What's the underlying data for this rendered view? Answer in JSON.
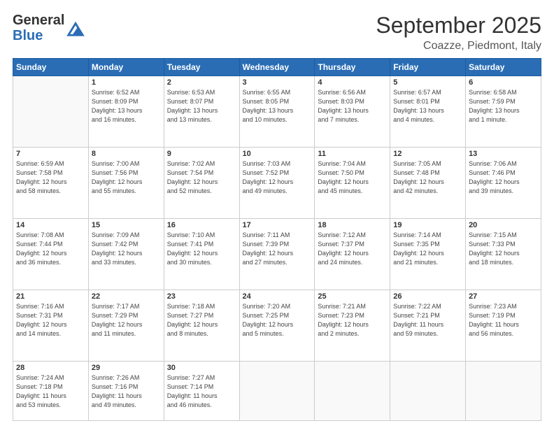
{
  "logo": {
    "general": "General",
    "blue": "Blue"
  },
  "header": {
    "month": "September 2025",
    "location": "Coazze, Piedmont, Italy"
  },
  "weekdays": [
    "Sunday",
    "Monday",
    "Tuesday",
    "Wednesday",
    "Thursday",
    "Friday",
    "Saturday"
  ],
  "weeks": [
    [
      {
        "day": null,
        "info": null
      },
      {
        "day": "1",
        "info": "Sunrise: 6:52 AM\nSunset: 8:09 PM\nDaylight: 13 hours\nand 16 minutes."
      },
      {
        "day": "2",
        "info": "Sunrise: 6:53 AM\nSunset: 8:07 PM\nDaylight: 13 hours\nand 13 minutes."
      },
      {
        "day": "3",
        "info": "Sunrise: 6:55 AM\nSunset: 8:05 PM\nDaylight: 13 hours\nand 10 minutes."
      },
      {
        "day": "4",
        "info": "Sunrise: 6:56 AM\nSunset: 8:03 PM\nDaylight: 13 hours\nand 7 minutes."
      },
      {
        "day": "5",
        "info": "Sunrise: 6:57 AM\nSunset: 8:01 PM\nDaylight: 13 hours\nand 4 minutes."
      },
      {
        "day": "6",
        "info": "Sunrise: 6:58 AM\nSunset: 7:59 PM\nDaylight: 13 hours\nand 1 minute."
      }
    ],
    [
      {
        "day": "7",
        "info": "Sunrise: 6:59 AM\nSunset: 7:58 PM\nDaylight: 12 hours\nand 58 minutes."
      },
      {
        "day": "8",
        "info": "Sunrise: 7:00 AM\nSunset: 7:56 PM\nDaylight: 12 hours\nand 55 minutes."
      },
      {
        "day": "9",
        "info": "Sunrise: 7:02 AM\nSunset: 7:54 PM\nDaylight: 12 hours\nand 52 minutes."
      },
      {
        "day": "10",
        "info": "Sunrise: 7:03 AM\nSunset: 7:52 PM\nDaylight: 12 hours\nand 49 minutes."
      },
      {
        "day": "11",
        "info": "Sunrise: 7:04 AM\nSunset: 7:50 PM\nDaylight: 12 hours\nand 45 minutes."
      },
      {
        "day": "12",
        "info": "Sunrise: 7:05 AM\nSunset: 7:48 PM\nDaylight: 12 hours\nand 42 minutes."
      },
      {
        "day": "13",
        "info": "Sunrise: 7:06 AM\nSunset: 7:46 PM\nDaylight: 12 hours\nand 39 minutes."
      }
    ],
    [
      {
        "day": "14",
        "info": "Sunrise: 7:08 AM\nSunset: 7:44 PM\nDaylight: 12 hours\nand 36 minutes."
      },
      {
        "day": "15",
        "info": "Sunrise: 7:09 AM\nSunset: 7:42 PM\nDaylight: 12 hours\nand 33 minutes."
      },
      {
        "day": "16",
        "info": "Sunrise: 7:10 AM\nSunset: 7:41 PM\nDaylight: 12 hours\nand 30 minutes."
      },
      {
        "day": "17",
        "info": "Sunrise: 7:11 AM\nSunset: 7:39 PM\nDaylight: 12 hours\nand 27 minutes."
      },
      {
        "day": "18",
        "info": "Sunrise: 7:12 AM\nSunset: 7:37 PM\nDaylight: 12 hours\nand 24 minutes."
      },
      {
        "day": "19",
        "info": "Sunrise: 7:14 AM\nSunset: 7:35 PM\nDaylight: 12 hours\nand 21 minutes."
      },
      {
        "day": "20",
        "info": "Sunrise: 7:15 AM\nSunset: 7:33 PM\nDaylight: 12 hours\nand 18 minutes."
      }
    ],
    [
      {
        "day": "21",
        "info": "Sunrise: 7:16 AM\nSunset: 7:31 PM\nDaylight: 12 hours\nand 14 minutes."
      },
      {
        "day": "22",
        "info": "Sunrise: 7:17 AM\nSunset: 7:29 PM\nDaylight: 12 hours\nand 11 minutes."
      },
      {
        "day": "23",
        "info": "Sunrise: 7:18 AM\nSunset: 7:27 PM\nDaylight: 12 hours\nand 8 minutes."
      },
      {
        "day": "24",
        "info": "Sunrise: 7:20 AM\nSunset: 7:25 PM\nDaylight: 12 hours\nand 5 minutes."
      },
      {
        "day": "25",
        "info": "Sunrise: 7:21 AM\nSunset: 7:23 PM\nDaylight: 12 hours\nand 2 minutes."
      },
      {
        "day": "26",
        "info": "Sunrise: 7:22 AM\nSunset: 7:21 PM\nDaylight: 11 hours\nand 59 minutes."
      },
      {
        "day": "27",
        "info": "Sunrise: 7:23 AM\nSunset: 7:19 PM\nDaylight: 11 hours\nand 56 minutes."
      }
    ],
    [
      {
        "day": "28",
        "info": "Sunrise: 7:24 AM\nSunset: 7:18 PM\nDaylight: 11 hours\nand 53 minutes."
      },
      {
        "day": "29",
        "info": "Sunrise: 7:26 AM\nSunset: 7:16 PM\nDaylight: 11 hours\nand 49 minutes."
      },
      {
        "day": "30",
        "info": "Sunrise: 7:27 AM\nSunset: 7:14 PM\nDaylight: 11 hours\nand 46 minutes."
      },
      {
        "day": null,
        "info": null
      },
      {
        "day": null,
        "info": null
      },
      {
        "day": null,
        "info": null
      },
      {
        "day": null,
        "info": null
      }
    ]
  ]
}
